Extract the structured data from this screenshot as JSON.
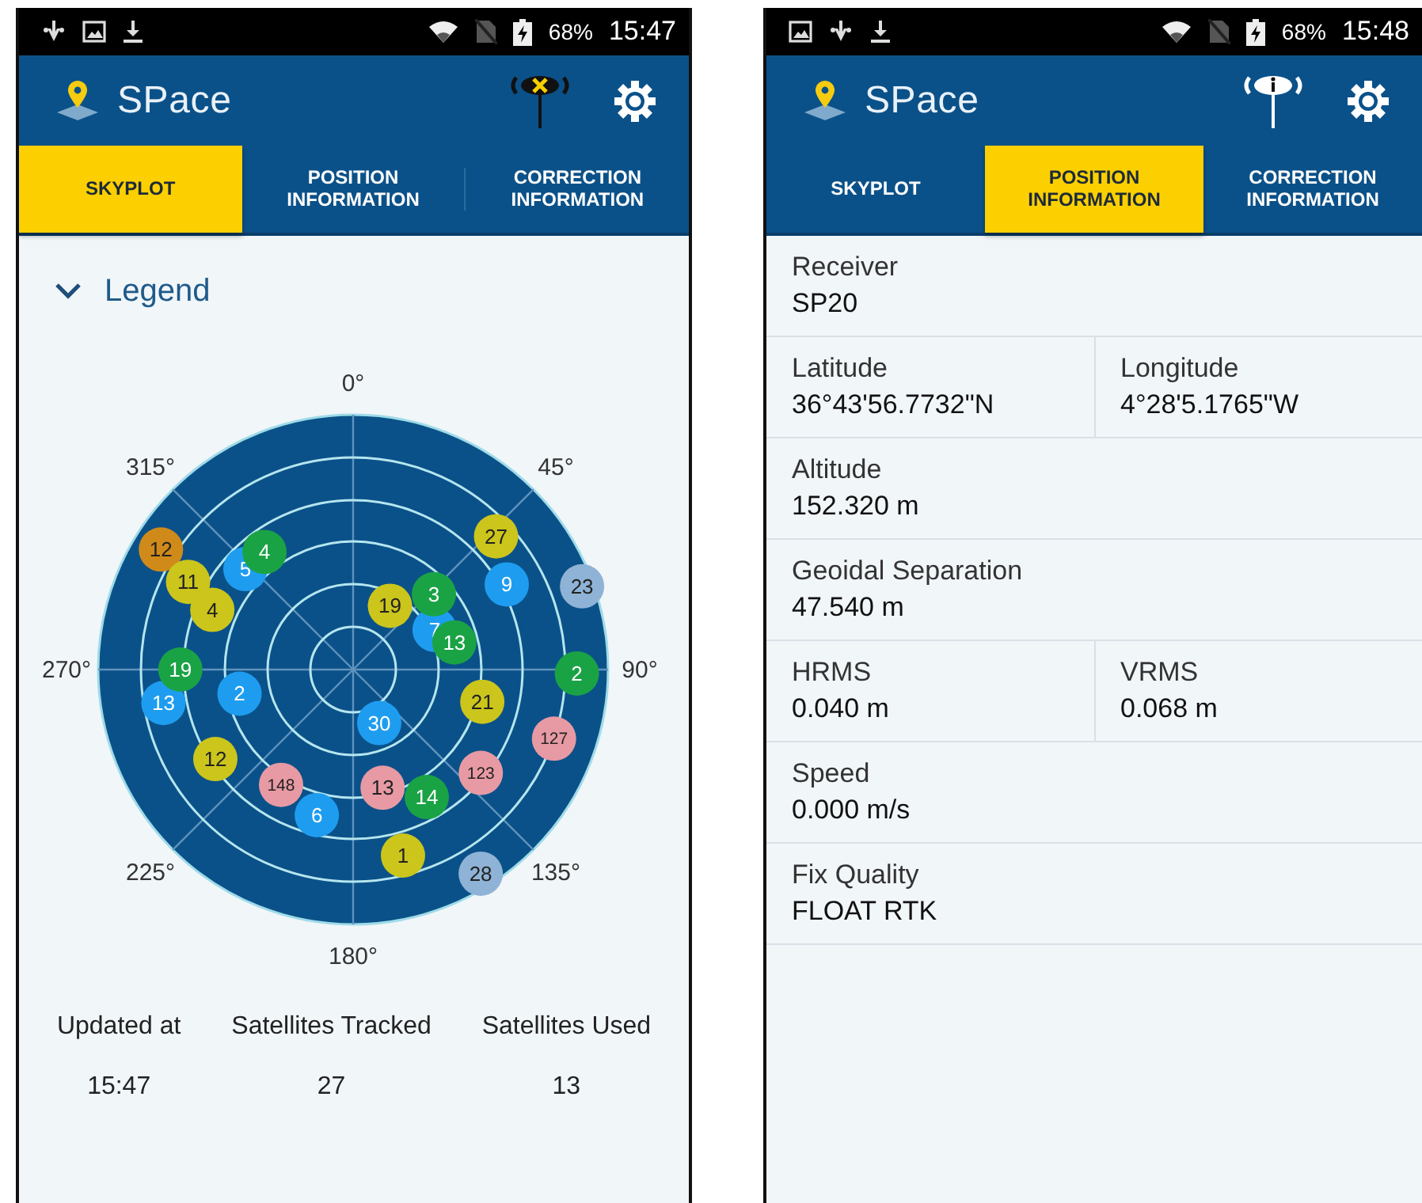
{
  "screens": [
    {
      "status_bar": {
        "left_icons": [
          {
            "kind": "usb"
          },
          {
            "kind": "image"
          },
          {
            "kind": "download"
          }
        ],
        "right_icons": [
          {
            "kind": "wifi"
          },
          {
            "kind": "no-sim"
          },
          {
            "kind": "battery"
          }
        ],
        "battery": "68%",
        "time": "15:47"
      },
      "app_bar": {
        "logo": "**SP**ace",
        "receiver_icon": {
          "kind": "no-fix"
        }
      },
      "tabs": [
        {
          "label": "SKYPLOT",
          "selected": true
        },
        {
          "label": "POSITION INFORMATION",
          "selected": false
        },
        {
          "label": "CORRECTION INFORMATION",
          "selected": false
        }
      ],
      "legend": {
        "label": "Legend",
        "expanded": false
      },
      "skyplot": {
        "azimuth_labels": [
          "0°",
          "45°",
          "90°",
          "135°",
          "180°",
          "225°",
          "270°",
          "315°"
        ],
        "satellites": [
          {
            "label": "12",
            "color": "#d08a1a"
          },
          {
            "label": "11",
            "color": "#cbc51c"
          },
          {
            "label": "4",
            "color": "#cbc51c"
          },
          {
            "label": "27",
            "color": "#cbc51c"
          },
          {
            "label": "19",
            "color": "#cbc51c"
          },
          {
            "label": "21",
            "color": "#cbc51c"
          },
          {
            "label": "12",
            "color": "#cbc51c"
          },
          {
            "label": "1",
            "color": "#cbc51c"
          },
          {
            "label": "5",
            "color": "#1e9df0"
          },
          {
            "label": "9",
            "color": "#1e9df0"
          },
          {
            "label": "7",
            "color": "#1e9df0"
          },
          {
            "label": "13",
            "color": "#1e9df0"
          },
          {
            "label": "2",
            "color": "#1e9df0"
          },
          {
            "label": "30",
            "color": "#1e9df0"
          },
          {
            "label": "6",
            "color": "#1e9df0"
          },
          {
            "label": "23",
            "color": "#8fb3d6"
          },
          {
            "label": "28",
            "color": "#8fb3d6"
          },
          {
            "label": "127",
            "color": "#e79aa4"
          },
          {
            "label": "123",
            "color": "#e79aa4"
          },
          {
            "label": "148",
            "color": "#e79aa4"
          },
          {
            "label": "13",
            "color": "#e79aa4"
          },
          {
            "label": "4",
            "color": "#1aa345"
          },
          {
            "label": "3",
            "color": "#1aa345"
          },
          {
            "label": "13",
            "color": "#1aa345"
          },
          {
            "label": "19",
            "color": "#1aa345"
          },
          {
            "label": "2",
            "color": "#1aa345"
          },
          {
            "label": "14",
            "color": "#1aa345"
          }
        ]
      },
      "stats": [
        {
          "label": "Updated at",
          "value": "15:47"
        },
        {
          "label": "Satellites Tracked",
          "value": "27"
        },
        {
          "label": "Satellites Used",
          "value": "13"
        }
      ]
    },
    {
      "status_bar": {
        "left_icons": [
          {
            "kind": "image"
          },
          {
            "kind": "usb"
          },
          {
            "kind": "download"
          }
        ],
        "right_icons": [
          {
            "kind": "wifi"
          },
          {
            "kind": "no-sim"
          },
          {
            "kind": "battery"
          }
        ],
        "battery": "68%",
        "time": "15:48"
      },
      "app_bar": {
        "logo": "**SP**ace",
        "receiver_icon": {
          "kind": "info"
        }
      },
      "tabs": [
        {
          "label": "SKYPLOT",
          "selected": false
        },
        {
          "label": "POSITION INFORMATION",
          "selected": true
        },
        {
          "label": "CORRECTION INFORMATION",
          "selected": false
        }
      ],
      "info_rows": [
        [
          {
            "label": "Receiver",
            "value": "SP20"
          }
        ],
        [
          {
            "label": "Latitude",
            "value": "36°43'56.7732\"N"
          },
          {
            "label": "Longitude",
            "value": "4°28'5.1765\"W"
          }
        ],
        [
          {
            "label": "Altitude",
            "value": "152.320 m"
          }
        ],
        [
          {
            "label": "Geoidal Separation",
            "value": "47.540 m"
          }
        ],
        [
          {
            "label": "HRMS",
            "value": "0.040 m"
          },
          {
            "label": "VRMS",
            "value": "0.068 m"
          }
        ],
        [
          {
            "label": "Speed",
            "value": "0.000 m/s"
          }
        ],
        [
          {
            "label": "Fix Quality",
            "value": "FLOAT RTK"
          }
        ]
      ]
    }
  ]
}
